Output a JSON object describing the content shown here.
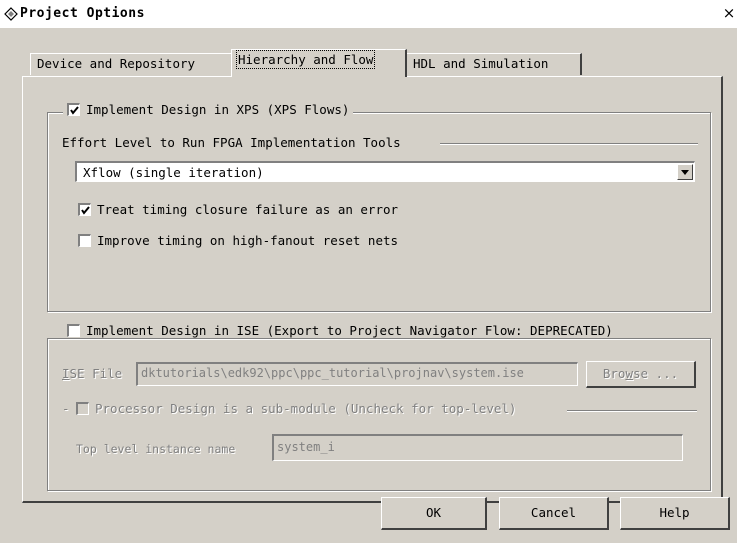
{
  "window": {
    "title": "Project Options",
    "close_glyph": "×"
  },
  "tabs": [
    {
      "label": "Device and Repository",
      "active": false
    },
    {
      "label": "Hierarchy and Flow",
      "active": true
    },
    {
      "label": "HDL and Simulation",
      "active": false
    }
  ],
  "xps_group": {
    "checkbox_label": "Implement Design in XPS (XPS Flows)",
    "checked": true,
    "effort_label": "Effort Level to Run FPGA Implementation Tools",
    "effort_selected": "Xflow (single iteration)",
    "treat_timing_label": "Treat timing closure failure as an error",
    "treat_timing_checked": true,
    "improve_timing_label": "Improve timing on high-fanout reset nets",
    "improve_timing_checked": false
  },
  "ise_group": {
    "checkbox_label": "Implement Design in ISE (Export to Project Navigator Flow: DEPRECATED)",
    "checked": false,
    "ise_file_label_accel": "I",
    "ise_file_label_rest": "SE File",
    "ise_file_value": "dktutorials\\edk92\\ppc\\ppc_tutorial\\projnav\\system.ise",
    "browse_label_pre": "Bro",
    "browse_label_accel": "w",
    "browse_label_post": "se ...",
    "submodule_prefix": "-",
    "submodule_label": "Processor Design is a sub-module (Uncheck for top-level)",
    "submodule_checked": false,
    "top_level_label": "Top level instance name",
    "top_level_value": "system_i"
  },
  "buttons": {
    "ok": "OK",
    "cancel": "Cancel",
    "help": "Help"
  },
  "colors": {
    "dialog_face": "#d4d0c8",
    "disabled_text": "#808080"
  },
  "icons": {
    "title": "diamond-app-icon",
    "check": "checkmark-icon",
    "dropdown": "chevron-down-icon"
  }
}
